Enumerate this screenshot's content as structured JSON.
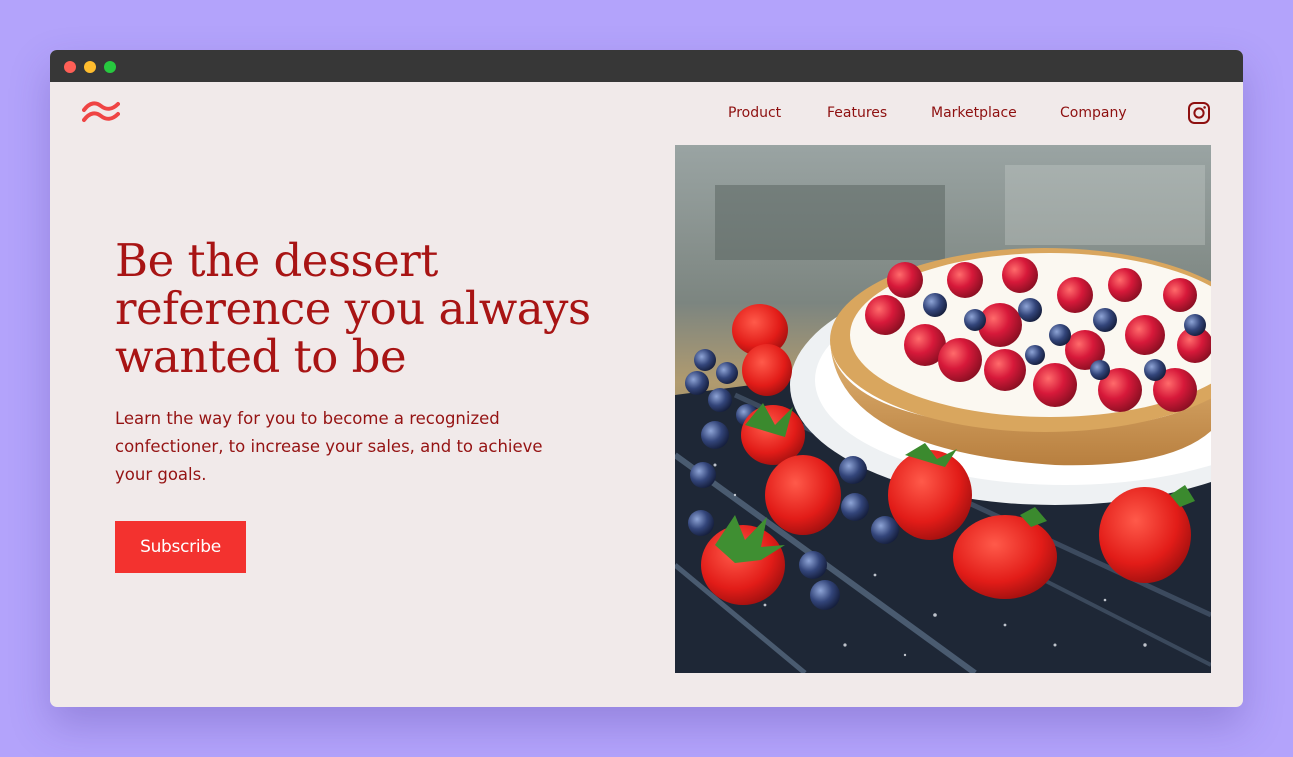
{
  "nav": {
    "links": [
      "Product",
      "Features",
      "Marketplace",
      "Company"
    ]
  },
  "icons": {
    "logo": "wave-logo-icon",
    "social": "instagram-icon"
  },
  "hero": {
    "headline": "Be the dessert reference you always wanted to be",
    "subtext": "Learn the way for you to become a recognized confectioner, to increase your sales, and to achieve your goals.",
    "cta_label": "Subscribe"
  },
  "colors": {
    "page_background": "#b3a3fb",
    "window_background": "#f1eaea",
    "titlebar": "#373737",
    "brand_red": "#a81414",
    "button_red": "#f3322f"
  }
}
